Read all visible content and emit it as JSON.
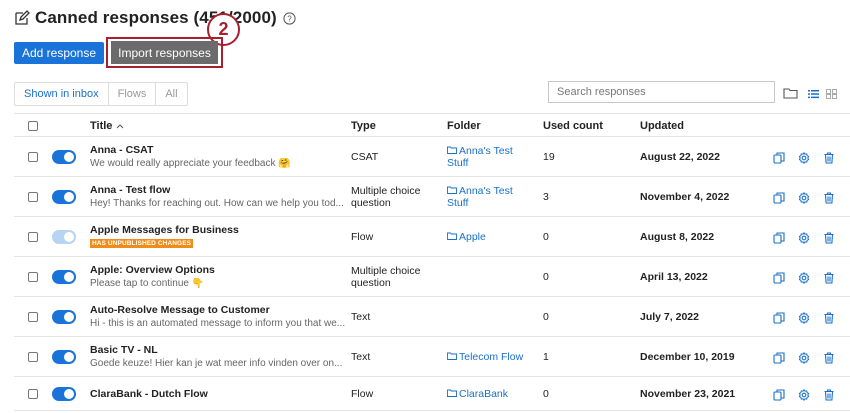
{
  "header": {
    "title": "Canned responses (451/2000)"
  },
  "callout": "2",
  "toolbar": {
    "add_label": "Add response",
    "import_label": "Import responses"
  },
  "tabs": [
    {
      "label": "Shown in inbox"
    },
    {
      "label": "Flows"
    },
    {
      "label": "All"
    }
  ],
  "search": {
    "placeholder": "Search responses"
  },
  "table": {
    "columns": {
      "title": "Title",
      "type": "Type",
      "folder": "Folder",
      "used": "Used count",
      "updated": "Updated"
    },
    "rows": [
      {
        "name": "Anna - CSAT",
        "preview": "We would really appreciate your feedback 🤗",
        "type": [
          "CSAT"
        ],
        "folder": [
          "Anna's Test",
          "Stuff"
        ],
        "used": "19",
        "updated": "August 22, 2022",
        "enabled": true
      },
      {
        "name": "Anna - Test flow",
        "preview": "Hey! Thanks for reaching out. How can we help you tod...",
        "type": [
          "Multiple choice",
          "question"
        ],
        "folder": [
          "Anna's Test",
          "Stuff"
        ],
        "used": "3",
        "updated": "November 4, 2022",
        "enabled": true
      },
      {
        "name": "Apple Messages for Business",
        "badge": "HAS UNPUBLISHED CHANGES",
        "type": [
          "Flow"
        ],
        "folder": [
          "Apple"
        ],
        "used": "0",
        "updated": "August 8, 2022",
        "enabled": false
      },
      {
        "name": "Apple: Overview Options",
        "preview": "Please tap to continue 👇",
        "type": [
          "Multiple choice",
          "question"
        ],
        "folder": [],
        "used": "0",
        "updated": "April 13, 2022",
        "enabled": true
      },
      {
        "name": "Auto-Resolve Message to Customer",
        "preview": "Hi - this is an automated message to inform you that we...",
        "type": [
          "Text"
        ],
        "folder": [],
        "used": "0",
        "updated": "July 7, 2022",
        "enabled": true
      },
      {
        "name": "Basic TV - NL",
        "preview": "Goede keuze! Hier kan je wat meer info vinden over on...",
        "type": [
          "Text"
        ],
        "folder": [
          "Telecom Flow"
        ],
        "used": "1",
        "updated": "December 10, 2019",
        "enabled": true
      },
      {
        "name": "ClaraBank - Dutch Flow",
        "type": [
          "Flow"
        ],
        "folder": [
          "ClaraBank"
        ],
        "used": "0",
        "updated": "November 23, 2021",
        "enabled": true
      }
    ]
  },
  "colors": {
    "primary": "#1a73d9",
    "callout": "#a8202e",
    "badge": "#f08c1a",
    "link": "#1a6fc9"
  },
  "icons": [
    "edit-icon",
    "help-icon",
    "folder-icon",
    "list-view-icon",
    "grid-view-icon",
    "sort-asc-icon",
    "duplicate-icon",
    "settings-icon",
    "delete-icon"
  ]
}
